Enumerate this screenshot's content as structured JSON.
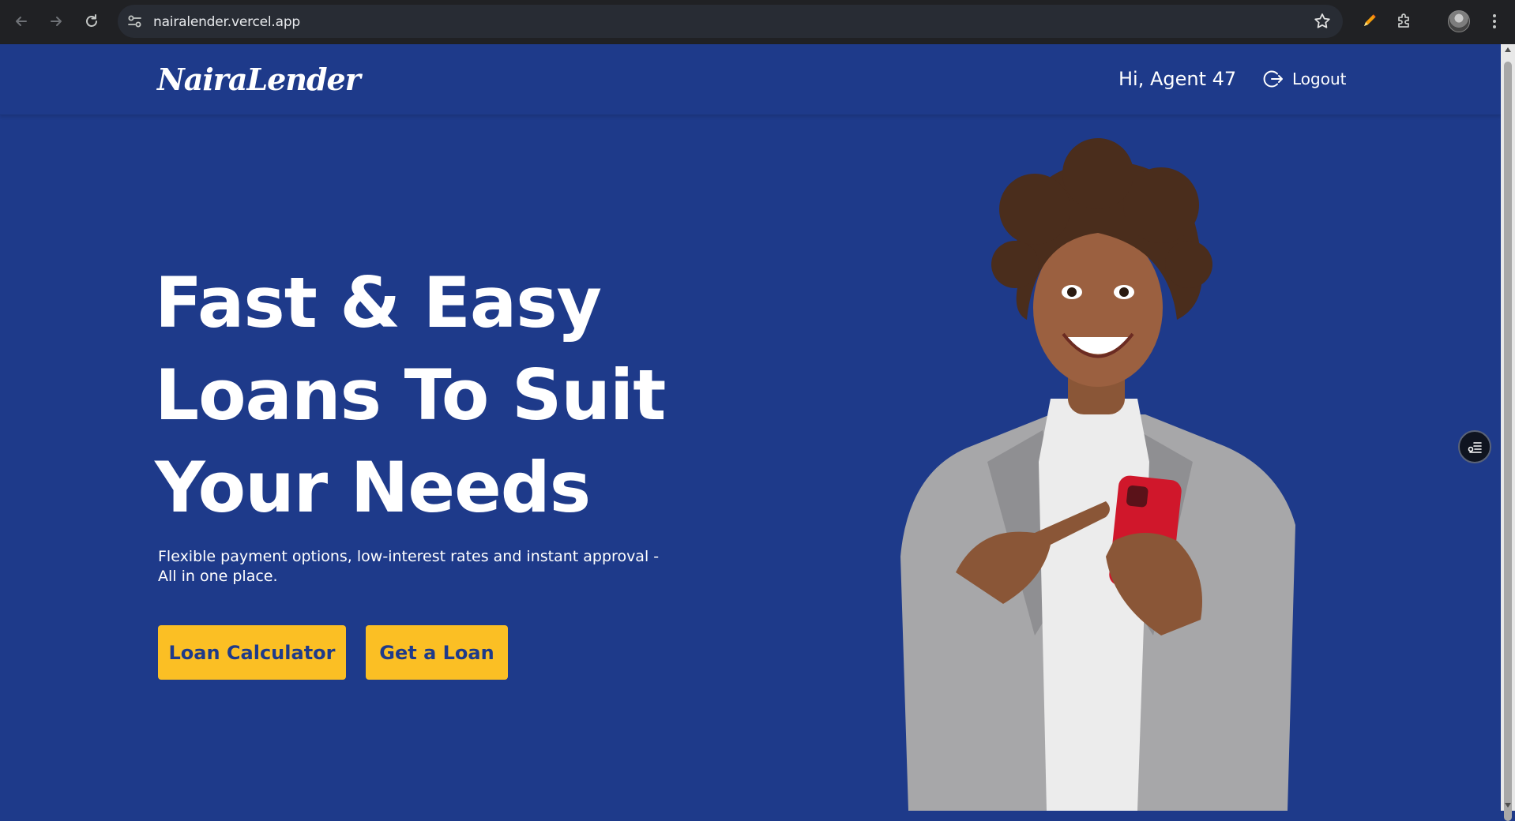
{
  "browser": {
    "url": "nairalender.vercel.app",
    "icons": {
      "back": "arrow-left-icon",
      "forward": "arrow-right-icon",
      "reload": "reload-icon",
      "site_info": "tune-icon",
      "bookmark": "star-icon",
      "extension_1": "pencil-icon",
      "extensions": "puzzle-icon",
      "profile": "avatar",
      "menu": "kebab-icon"
    }
  },
  "header": {
    "logo": "NairaLender",
    "greeting": "Hi, Agent 47",
    "logout_label": "Logout"
  },
  "hero": {
    "title_lines": [
      "Fast & Easy",
      "Loans To Suit",
      "Your Needs"
    ],
    "subtitle": "Flexible payment options, low-interest rates and instant approval - All in one place.",
    "buttons": {
      "loan_calculator": "Loan Calculator",
      "get_loan": "Get a Loan"
    }
  },
  "colors": {
    "background": "#1e3a8a",
    "accent_button": "#fbbf24",
    "button_text": "#1e3a8a",
    "text": "#ffffff"
  }
}
